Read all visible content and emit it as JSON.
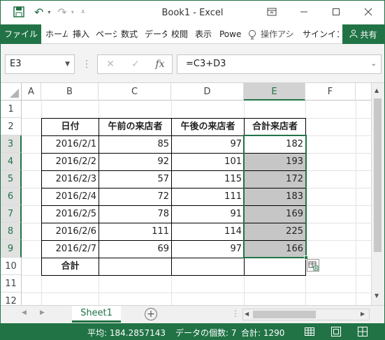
{
  "window": {
    "title": "Book1 - Excel"
  },
  "ribbon": {
    "file": "ファイル",
    "tabs": [
      "ホーム",
      "挿入",
      "ページ",
      "数式",
      "データ",
      "校閲",
      "表示",
      "Powe"
    ],
    "tell_me": "操作アシ",
    "signin": "サインイン",
    "share": "共有"
  },
  "formula_bar": {
    "name_box": "E3",
    "formula": "=C3+D3",
    "fx": "fx"
  },
  "grid": {
    "columns": [
      "A",
      "B",
      "C",
      "D",
      "E",
      "F"
    ],
    "rows": [
      "1",
      "2",
      "3",
      "4",
      "5",
      "6",
      "7",
      "8",
      "9",
      "10",
      "11",
      "12"
    ],
    "headers": {
      "date": "日付",
      "am": "午前の来店者",
      "pm": "午後の来店者",
      "total": "合計来店者"
    },
    "data": [
      {
        "date": "2016/2/1",
        "am": "85",
        "pm": "97",
        "total": "182"
      },
      {
        "date": "2016/2/2",
        "am": "92",
        "pm": "101",
        "total": "193"
      },
      {
        "date": "2016/2/3",
        "am": "57",
        "pm": "115",
        "total": "172"
      },
      {
        "date": "2016/2/4",
        "am": "72",
        "pm": "111",
        "total": "183"
      },
      {
        "date": "2016/2/5",
        "am": "78",
        "pm": "91",
        "total": "169"
      },
      {
        "date": "2016/2/6",
        "am": "111",
        "pm": "114",
        "total": "225"
      },
      {
        "date": "2016/2/7",
        "am": "69",
        "pm": "97",
        "total": "166"
      }
    ],
    "sum_label": "合計"
  },
  "sheets": {
    "active": "Sheet1"
  },
  "status": {
    "average": "平均: 184.2857143",
    "count": "データの個数: 7",
    "sum": "合計: 1290"
  },
  "colors": {
    "accent": "#217346",
    "fill_gray": "#c6c6c6"
  }
}
